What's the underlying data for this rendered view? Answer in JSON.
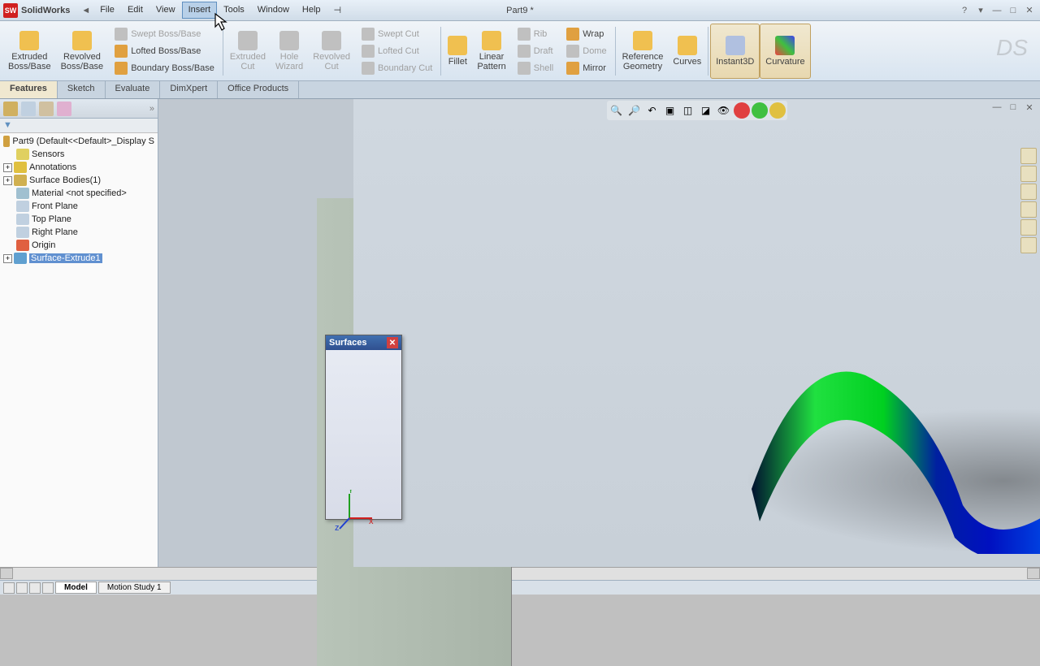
{
  "app": {
    "name": "SolidWorks",
    "doc": "Part9 *"
  },
  "menu": {
    "file": "File",
    "edit": "Edit",
    "view": "View",
    "insert": "Insert",
    "tools": "Tools",
    "window": "Window",
    "help": "Help"
  },
  "ribbon": {
    "extruded_boss": "Extruded\nBoss/Base",
    "revolved_boss": "Revolved\nBoss/Base",
    "swept_boss": "Swept Boss/Base",
    "lofted_boss": "Lofted Boss/Base",
    "boundary_boss": "Boundary Boss/Base",
    "extruded_cut": "Extruded\nCut",
    "hole_wizard": "Hole\nWizard",
    "revolved_cut": "Revolved\nCut",
    "swept_cut": "Swept Cut",
    "lofted_cut": "Lofted Cut",
    "boundary_cut": "Boundary Cut",
    "fillet": "Fillet",
    "linear_pattern": "Linear\nPattern",
    "rib": "Rib",
    "draft": "Draft",
    "shell": "Shell",
    "wrap": "Wrap",
    "dome": "Dome",
    "mirror": "Mirror",
    "ref_geom": "Reference\nGeometry",
    "curves": "Curves",
    "instant3d": "Instant3D",
    "curvature": "Curvature"
  },
  "tabs": {
    "features": "Features",
    "sketch": "Sketch",
    "evaluate": "Evaluate",
    "dimxpert": "DimXpert",
    "office": "Office Products"
  },
  "tree": {
    "root": "Part9 (Default<<Default>_Display S",
    "sensors": "Sensors",
    "annotations": "Annotations",
    "surface_bodies": "Surface Bodies(1)",
    "material": "Material <not specified>",
    "front_plane": "Front Plane",
    "top_plane": "Top Plane",
    "right_plane": "Right Plane",
    "origin": "Origin",
    "surface_extrude": "Surface-Extrude1"
  },
  "float": {
    "title": "Surfaces"
  },
  "bottom": {
    "model": "Model",
    "motion": "Motion Study 1"
  }
}
